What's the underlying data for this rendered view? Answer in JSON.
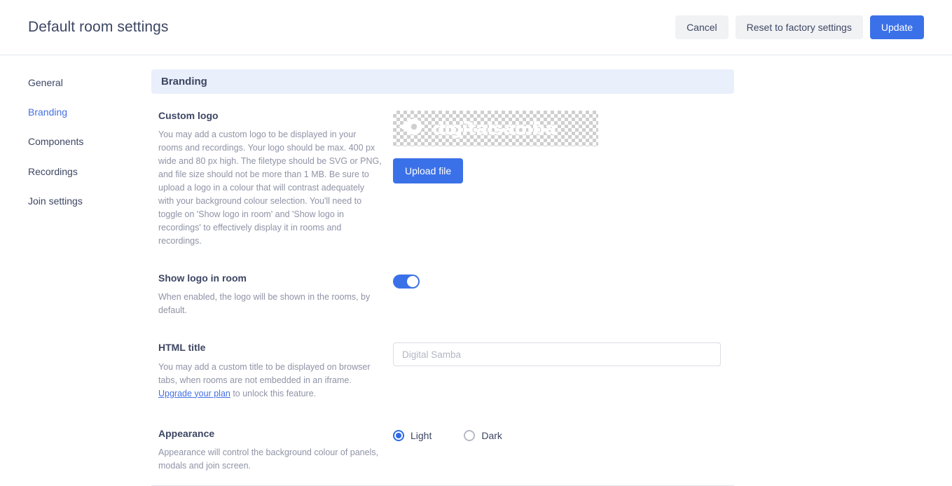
{
  "header": {
    "title": "Default room settings",
    "actions": [
      {
        "label": "Cancel",
        "style": "secondary"
      },
      {
        "label": "Reset to factory settings",
        "style": "secondary"
      },
      {
        "label": "Update",
        "style": "primary"
      }
    ]
  },
  "sidebar": {
    "items": [
      {
        "label": "General",
        "active": false
      },
      {
        "label": "Branding",
        "active": true
      },
      {
        "label": "Components",
        "active": false
      },
      {
        "label": "Recordings",
        "active": false
      },
      {
        "label": "Join settings",
        "active": false
      }
    ]
  },
  "main": {
    "section_title": "Branding",
    "custom_logo": {
      "label": "Custom logo",
      "description": "You may add a custom logo to be displayed in your rooms and recordings. Your logo should be max. 400 px wide and 80 px high. The filetype should be SVG or PNG, and file size should not be more than 1 MB. Be sure to upload a logo in a colour that will contrast adequately with your background colour selection. You'll need to toggle on 'Show logo in room' and 'Show logo in recordings' to effectively display it in rooms and recordings.",
      "logo_text": "digitalsamba",
      "upload_button": "Upload file"
    },
    "show_logo_in_room": {
      "label": "Show logo in room",
      "description": "When enabled, the logo will be shown in the rooms, by default.",
      "enabled": true
    },
    "html_title": {
      "label": "HTML title",
      "description_part1": "You may add a custom title to be displayed on browser tabs, when rooms are not embedded in an iframe. ",
      "link_text": "Upgrade your plan",
      "description_part2": " to unlock this feature.",
      "input_value": "",
      "input_placeholder": "Digital Samba"
    },
    "appearance": {
      "label": "Appearance",
      "description": "Appearance will control the background colour of panels, modals and join screen.",
      "options": [
        {
          "label": "Light",
          "selected": true
        },
        {
          "label": "Dark",
          "selected": false
        }
      ]
    }
  },
  "colors": {
    "accent": "#3b71e8",
    "section_bg": "#e9effb",
    "text": "#3d4663",
    "muted": "#8f93a6"
  }
}
